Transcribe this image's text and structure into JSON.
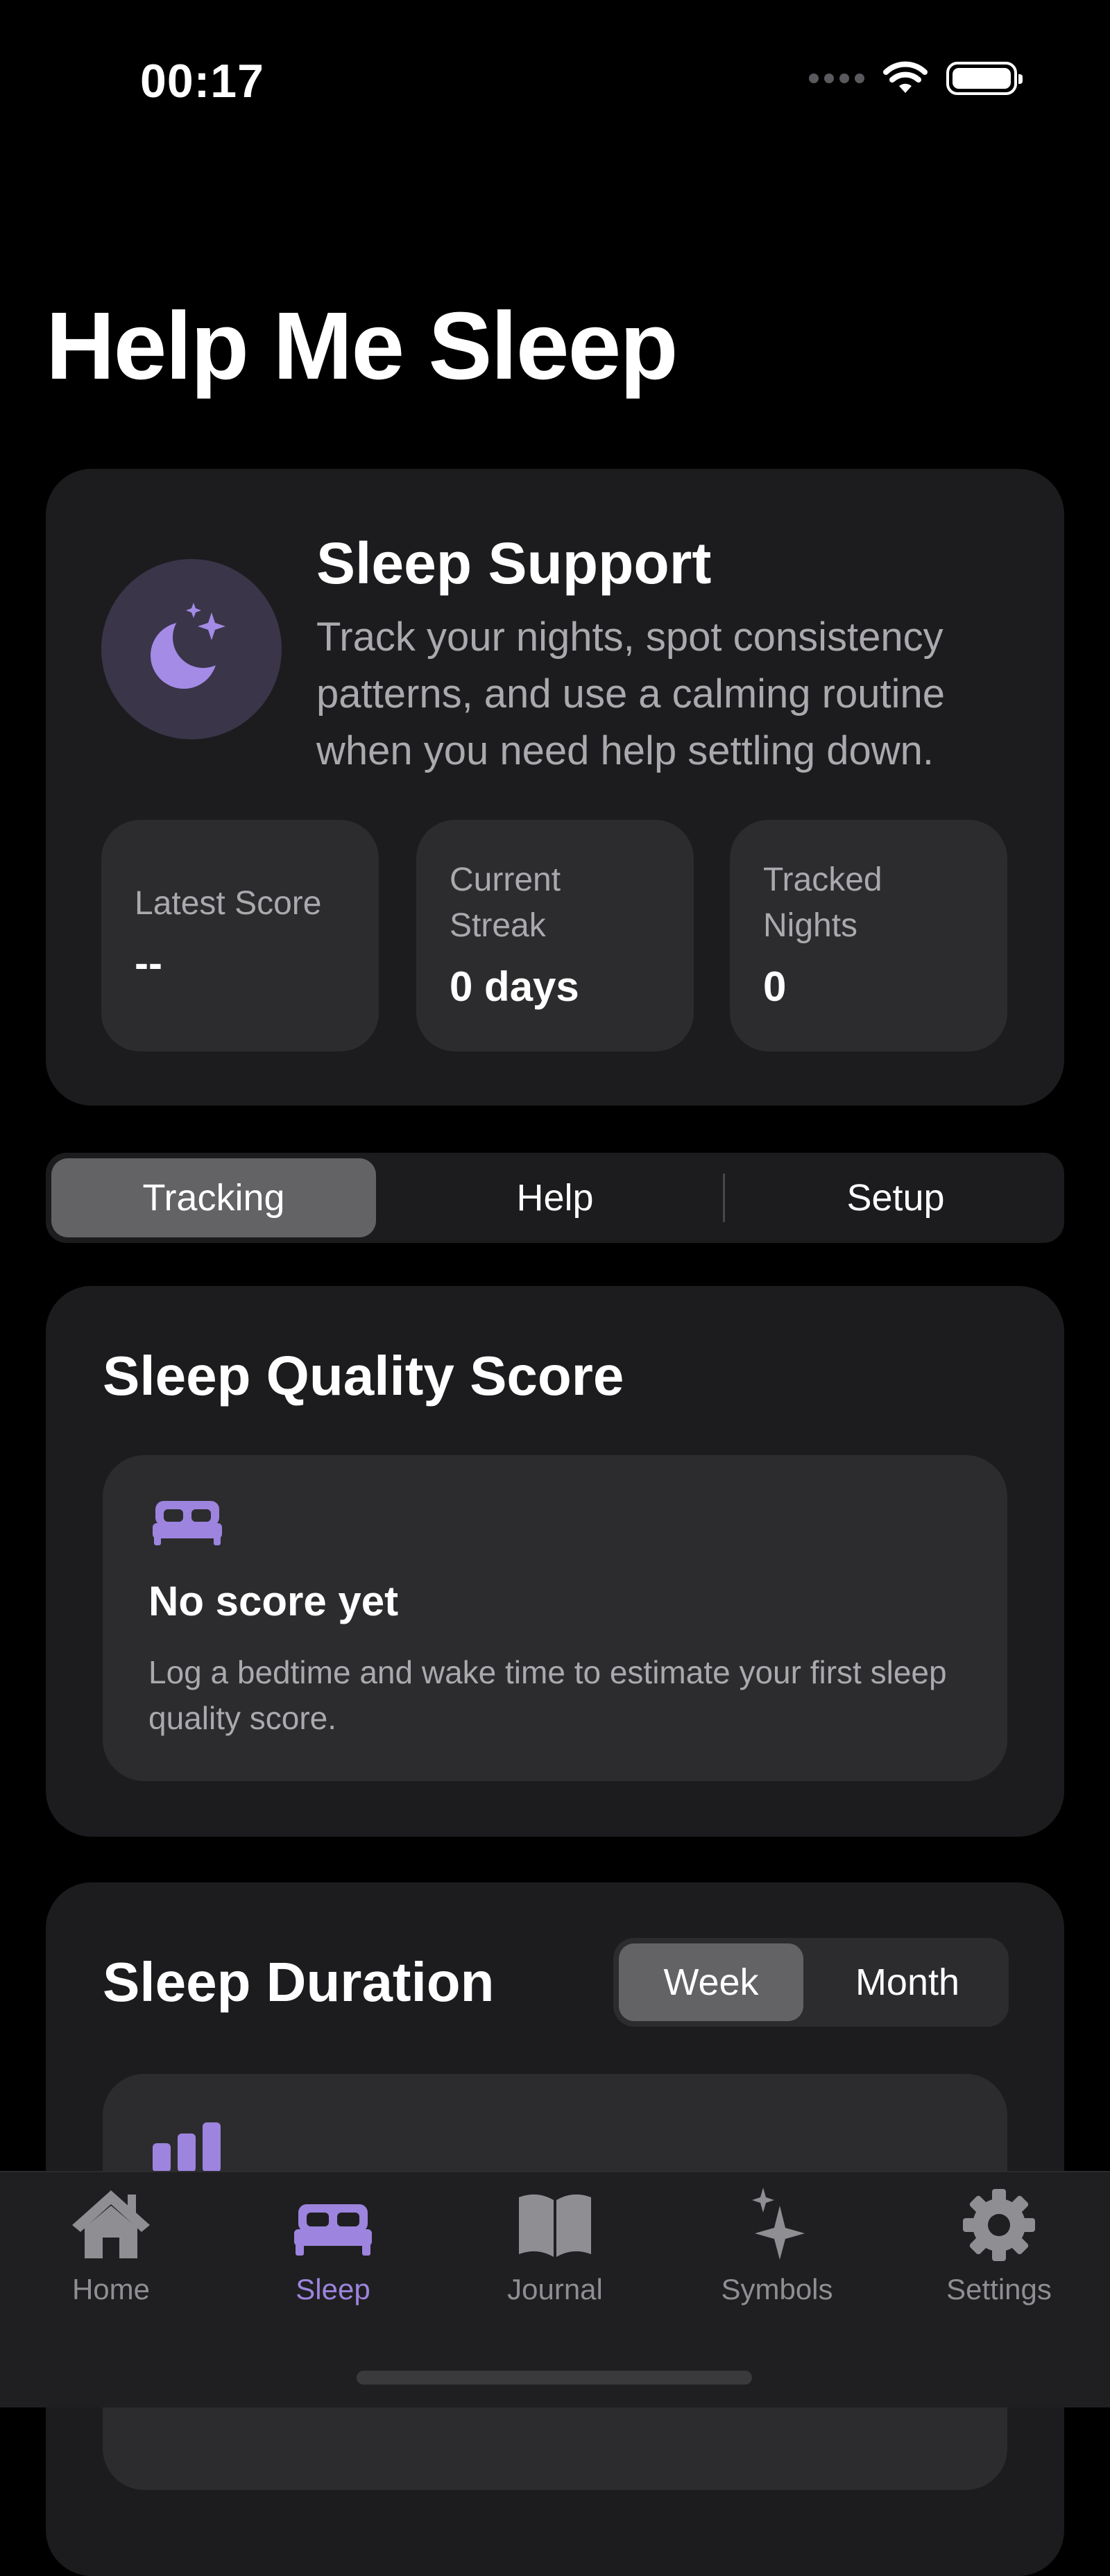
{
  "status_bar": {
    "time": "00:17"
  },
  "page": {
    "title": "Help Me Sleep"
  },
  "hero": {
    "title": "Sleep Support",
    "description": "Track your nights, spot consistency patterns, and use a calming routine when you need help settling down.",
    "stats": [
      {
        "label": "Latest Score",
        "value": "--"
      },
      {
        "label": "Current Streak",
        "value": "0 days"
      },
      {
        "label": "Tracked Nights",
        "value": "0"
      }
    ]
  },
  "segment": {
    "tabs": [
      "Tracking",
      "Help",
      "Setup"
    ],
    "selected": "Tracking"
  },
  "quality": {
    "title": "Sleep Quality Score",
    "empty_title": "No score yet",
    "empty_desc": "Log a bedtime and wake time to estimate your first sleep quality score."
  },
  "duration": {
    "title": "Sleep Duration",
    "range_options": [
      "Week",
      "Month"
    ],
    "selected_range": "Week"
  },
  "tab_bar": {
    "items": [
      {
        "label": "Home",
        "icon": "house-icon"
      },
      {
        "label": "Sleep",
        "icon": "bed-icon"
      },
      {
        "label": "Journal",
        "icon": "book-icon"
      },
      {
        "label": "Symbols",
        "icon": "sparkle-icon"
      },
      {
        "label": "Settings",
        "icon": "gear-icon"
      }
    ],
    "active": "Sleep"
  },
  "colors": {
    "accent": "#9d84de",
    "background": "#000000",
    "card": "#1c1c1e",
    "inner_card": "#2c2c2e",
    "secondary_text": "#a9a9ae"
  }
}
